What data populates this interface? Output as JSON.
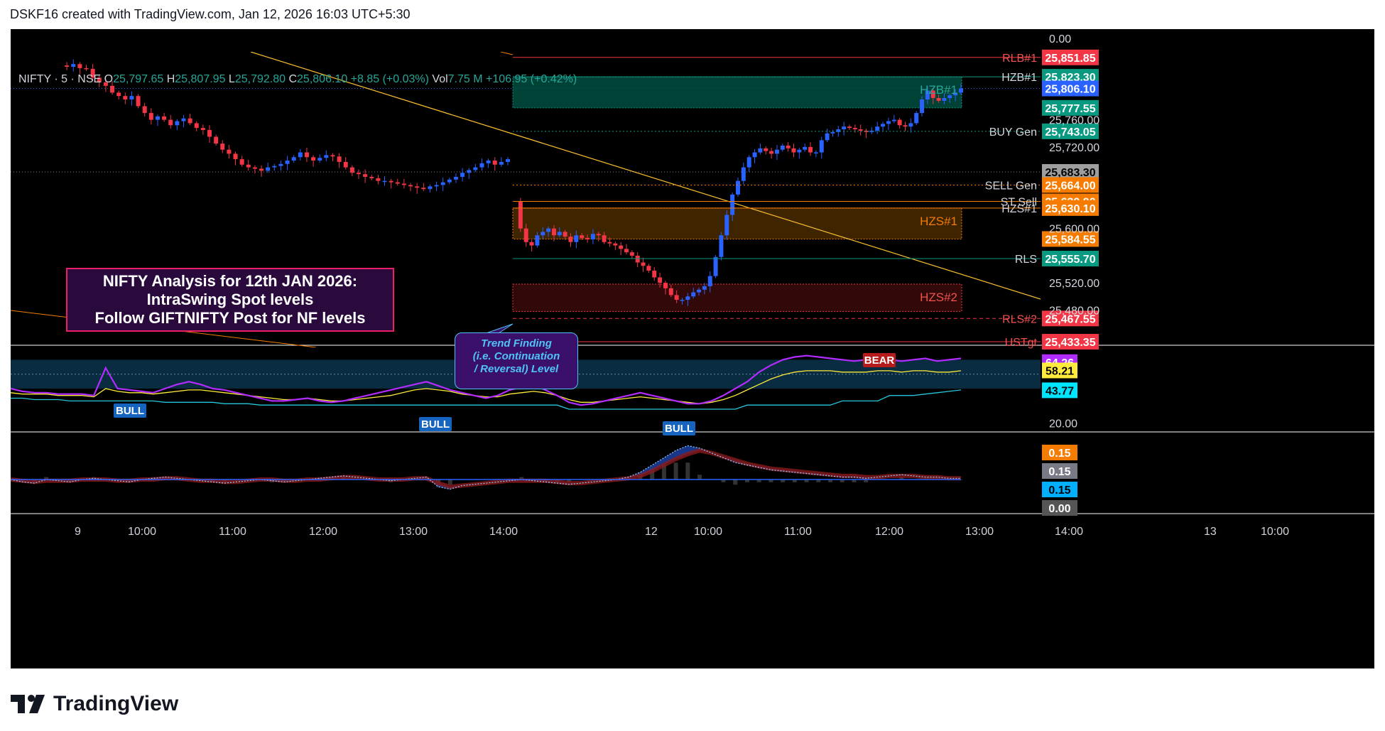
{
  "header": {
    "caption": "DSKF16 created with TradingView.com, Jan 12, 2026 16:03 UTC+5:30"
  },
  "legend": {
    "symbol": "NIFTY · 5 · NSE",
    "o_label": "O",
    "o": "25,797.65",
    "h_label": "H",
    "h": "25,807.95",
    "l_label": "L",
    "l": "25,792.80",
    "c_label": "C",
    "c": "25,806.10",
    "change": "+8.85 (+0.03%)",
    "vol_label": "Vol",
    "vol": "7.75 M",
    "vol_change": "+106.95 (+0.42%)"
  },
  "annotations": {
    "analysis_box": [
      "NIFTY Analysis for 12th JAN 2026:",
      "IntraSwing Spot levels",
      "Follow GIFTNIFTY Post for NF levels"
    ],
    "trend_finding": [
      "Trend Finding",
      "(i.e. Continuation",
      "/ Reversal) Level"
    ]
  },
  "branding": {
    "logo_text": "TradingView"
  },
  "colors": {
    "bull": "#2962ff",
    "bear": "#f23645",
    "rsi": "#b22cff",
    "rsi_signal": "#ffeb3b",
    "rsi_lower": "#26c6da",
    "trendline": "#fbc02d"
  },
  "chart_data": [
    {
      "type": "candlestick",
      "symbol": "NIFTY",
      "interval": "5",
      "exchange": "NSE",
      "x_ticks": [
        "9",
        "10:00",
        "11:00",
        "12:00",
        "13:00",
        "14:00",
        "12",
        "10:00",
        "11:00",
        "12:00",
        "13:00",
        "14:00",
        "13",
        "10:00"
      ],
      "y_ticks": [
        25480,
        25520,
        25600,
        25720,
        25760,
        "0.00"
      ],
      "ylim": [
        25425,
        25860
      ],
      "price_levels": [
        {
          "name": "RLB#1",
          "value": 25851.85,
          "label": "25,851.85",
          "color": "#f23645",
          "style": "solid"
        },
        {
          "name": "HZB#1",
          "value": 25823.3,
          "label": "25,823.30",
          "color": "#089981",
          "style": "zone-top"
        },
        {
          "name": "",
          "value": 25806.1,
          "label": "25,806.10",
          "color": "#2962ff",
          "style": "last"
        },
        {
          "name": "",
          "value": 25777.55,
          "label": "25,777.55",
          "color": "#089981",
          "style": "zone-bottom"
        },
        {
          "name": "BUY Gen",
          "value": 25743.05,
          "label": "25,743.05",
          "color": "#089981",
          "style": "dotted"
        },
        {
          "name": "",
          "value": 25683.3,
          "label": "25,683.30",
          "color": "#9e9e9e",
          "style": "prev-close"
        },
        {
          "name": "SELL Gen",
          "value": 25664.0,
          "label": "25,664.00",
          "color": "#f57c00",
          "style": "dotted"
        },
        {
          "name": "ST Sell",
          "value": 25639.9,
          "label": "25,639.90",
          "color": "#f57c00",
          "style": "solid"
        },
        {
          "name": "HZS#1",
          "value": 25630.1,
          "label": "25,630.10",
          "color": "#f57c00",
          "style": "zone-top"
        },
        {
          "name": "",
          "value": 25584.55,
          "label": "25,584.55",
          "color": "#f57c00",
          "style": "zone-bottom"
        },
        {
          "name": "RLS",
          "value": 25555.7,
          "label": "25,555.70",
          "color": "#089981",
          "style": "solid"
        },
        {
          "name": "RLS#2",
          "value": 25467.55,
          "label": "25,467.55",
          "color": "#f23645",
          "style": "dashed"
        },
        {
          "name": "USTgt",
          "value": 25433.35,
          "label": "25,433.35",
          "color": "#f23645",
          "style": "solid"
        }
      ],
      "zones": [
        {
          "name": "HZB#1",
          "top": 25823.3,
          "bottom": 25777.55,
          "color": "#004d40"
        },
        {
          "name": "HZS#1",
          "top": 25630.1,
          "bottom": 25584.55,
          "color": "#4a2a00"
        },
        {
          "name": "HZS#2",
          "top": 25518,
          "bottom": 25478,
          "color": "#3a0a0a"
        }
      ],
      "close_series_day1": [
        25840,
        25838,
        25842,
        25836,
        25835,
        25822,
        25815,
        25810,
        25800,
        25795,
        25790,
        25795,
        25780,
        25770,
        25760,
        25765,
        25760,
        25752,
        25758,
        25762,
        25755,
        25748,
        25745,
        25735,
        25725,
        25716,
        25710,
        25702,
        25694,
        25690,
        25688,
        25685,
        25690,
        25692,
        25695,
        25700,
        25705,
        25712,
        25705,
        25700,
        25704,
        25708,
        25706,
        25698,
        25690,
        25682,
        25680,
        25676,
        25674,
        25670,
        25670,
        25668,
        25666,
        25664,
        25662,
        25660,
        25658,
        25662,
        25664,
        25668,
        25672,
        25676,
        25682,
        25686,
        25690,
        25696,
        25700,
        25694,
        25698,
        25702
      ],
      "close_series_day2": [
        25640,
        25600,
        25580,
        25575,
        25590,
        25595,
        25600,
        25590,
        25595,
        25588,
        25580,
        25590,
        25586,
        25584,
        25592,
        25590,
        25580,
        25578,
        25575,
        25570,
        25565,
        25560,
        25550,
        25545,
        25538,
        25528,
        25520,
        25512,
        25502,
        25495,
        25495,
        25500,
        25506,
        25510,
        25515,
        25530,
        25558,
        25590,
        25620,
        25650,
        25670,
        25690,
        25705,
        25712,
        25718,
        25714,
        25710,
        25716,
        25722,
        25718,
        25712,
        25716,
        25720,
        25712,
        25712,
        25730,
        25740,
        25742,
        25746,
        25750,
        25748,
        25746,
        25744,
        25742,
        25744,
        25750,
        25754,
        25758,
        25760,
        25752,
        25750,
        25755,
        25770,
        25790,
        25803,
        25792,
        25788,
        25792,
        25796,
        25800,
        25806.1
      ]
    },
    {
      "type": "line",
      "name": "RSI panel",
      "y_ticks": [
        "20.00"
      ],
      "current_values": [
        "64.26",
        "58.21",
        "43.77"
      ],
      "signals": [
        "BULL",
        "BULL",
        "BULL",
        "BEAR"
      ],
      "ylim": [
        15,
        75
      ],
      "series": [
        {
          "name": "",
          "color": "#b22cff",
          "values": [
            45,
            43,
            42,
            42,
            41,
            41,
            41,
            40,
            60,
            45,
            44,
            43,
            42,
            45,
            48,
            50,
            48,
            45,
            44,
            42,
            40,
            38,
            36,
            36,
            37,
            38,
            36,
            35,
            36,
            38,
            40,
            42,
            44,
            46,
            48,
            50,
            47,
            44,
            42,
            40,
            38,
            40,
            44,
            46,
            48,
            44,
            40,
            35,
            33,
            34,
            36,
            38,
            40,
            42,
            40,
            38,
            36,
            34,
            34,
            36,
            40,
            45,
            50,
            57,
            62,
            66,
            68,
            69,
            68,
            67,
            66,
            65,
            66,
            67,
            66,
            65,
            66,
            67,
            65,
            66,
            67
          ]
        },
        {
          "name": "",
          "color": "#ffeb3b",
          "values": [
            42,
            41,
            41,
            41,
            40,
            40,
            40,
            39,
            45,
            43,
            42,
            42,
            41,
            42,
            43,
            44,
            44,
            43,
            42,
            41,
            40,
            39,
            38,
            37,
            37,
            38,
            37,
            36,
            36,
            37,
            38,
            39,
            40,
            42,
            44,
            45,
            44,
            43,
            41,
            40,
            39,
            39,
            41,
            42,
            43,
            42,
            40,
            37,
            35,
            35,
            36,
            37,
            38,
            39,
            38,
            37,
            36,
            35,
            34,
            35,
            37,
            40,
            44,
            48,
            52,
            55,
            57,
            58,
            58,
            58,
            57,
            57,
            57,
            58,
            58,
            57,
            58,
            58,
            57,
            57,
            58
          ]
        },
        {
          "name": "",
          "color": "#26c6da",
          "values": [
            38,
            38,
            37,
            37,
            37,
            36,
            36,
            36,
            36,
            36,
            36,
            36,
            36,
            35,
            35,
            35,
            35,
            35,
            34,
            34,
            34,
            33,
            33,
            33,
            33,
            33,
            33,
            33,
            33,
            33,
            33,
            33,
            33,
            33,
            33,
            33,
            33,
            33,
            33,
            33,
            33,
            33,
            33,
            33,
            33,
            33,
            33,
            30,
            30,
            30,
            30,
            30,
            30,
            30,
            30,
            30,
            30,
            30,
            30,
            30,
            30,
            30,
            33,
            33,
            33,
            33,
            33,
            33,
            33,
            33,
            36,
            36,
            36,
            36,
            40,
            40,
            40,
            41,
            42,
            43,
            44
          ]
        }
      ]
    },
    {
      "type": "area",
      "name": "MACD panel",
      "current_values": [
        "0.15",
        "0.15",
        "0.15",
        "0.00"
      ],
      "series": [
        {
          "name": "",
          "color": "#2962ff",
          "values": [
            0,
            -2,
            -3,
            0,
            -1,
            -2,
            0,
            1,
            0,
            -1,
            -2,
            0,
            1,
            2,
            1,
            0,
            -1,
            -2,
            -3,
            -2,
            -1,
            0,
            -1,
            -2,
            -1,
            0,
            1,
            2,
            3,
            2,
            1,
            0,
            -1,
            0,
            1,
            2,
            -6,
            -8,
            -5,
            -4,
            -3,
            -2,
            -1,
            0,
            -1,
            -2,
            -3,
            -4,
            -3,
            -2,
            -1,
            0,
            2,
            6,
            12,
            18,
            24,
            28,
            26,
            22,
            18,
            14,
            12,
            10,
            8,
            7,
            6,
            5,
            4,
            3,
            2,
            2,
            1,
            2,
            3,
            4,
            3,
            2,
            2,
            1,
            1
          ]
        },
        {
          "name": "",
          "color": "#f23645",
          "values": [
            0,
            -1,
            -2,
            -1,
            -1,
            -1,
            0,
            0,
            0,
            -1,
            -1,
            0,
            0,
            1,
            1,
            0,
            -1,
            -1,
            -2,
            -2,
            -1,
            0,
            0,
            -1,
            -1,
            0,
            0,
            1,
            2,
            2,
            1,
            0,
            0,
            0,
            1,
            1,
            -3,
            -6,
            -5,
            -4,
            -3,
            -2,
            -1,
            -1,
            -1,
            -1,
            -2,
            -3,
            -3,
            -2,
            -1,
            0,
            1,
            3,
            7,
            12,
            17,
            21,
            24,
            22,
            19,
            16,
            13,
            11,
            9,
            8,
            7,
            6,
            5,
            4,
            3,
            3,
            2,
            2,
            3,
            3,
            3,
            2,
            2,
            1,
            1
          ]
        }
      ]
    }
  ]
}
